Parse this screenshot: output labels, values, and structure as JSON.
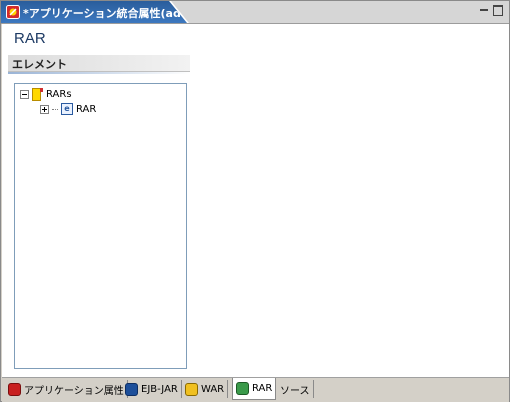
{
  "editor_tab": {
    "title": "*アプリケーション統合属性(adder)",
    "close": "✕"
  },
  "page": {
    "title": "RAR"
  },
  "section": {
    "title": "エレメント"
  },
  "tree": {
    "root_label": "RARs",
    "child_label": "RAR"
  },
  "bottom_tabs": [
    {
      "label": "アプリケーション属性",
      "icon": "application-icon"
    },
    {
      "label": "EJB-JAR",
      "icon": "ejb-jar-icon"
    },
    {
      "label": "WAR",
      "icon": "war-icon"
    },
    {
      "label": "RAR",
      "icon": "rar-icon",
      "active": true
    },
    {
      "label": "ソース"
    }
  ]
}
